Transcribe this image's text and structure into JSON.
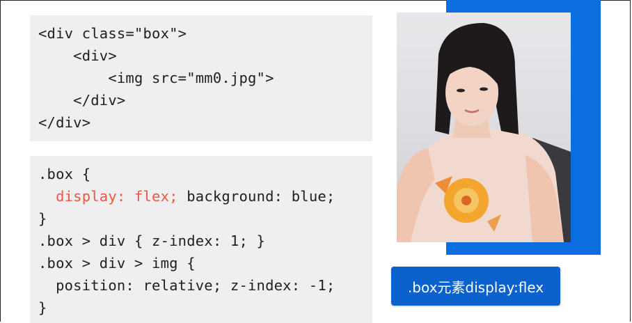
{
  "html_code": {
    "lines": [
      "<div class=\"box\">",
      "    <div>",
      "        <img src=\"mm0.jpg\">",
      "    </div>",
      "</div>"
    ]
  },
  "css_code": {
    "line1": ".box {",
    "line2_highlight": "  display: flex;",
    "line2_rest": " background: blue;",
    "line3": "}",
    "line4": ".box > div { z-index: 1; }",
    "line5": ".box > div > img {",
    "line6": "  position: relative; z-index: -1;",
    "line7": "}"
  },
  "label": {
    "text": ".box元素display:flex"
  },
  "colors": {
    "blue_box": "#0a6ee0",
    "label_bg": "#0c62cc",
    "highlight": "#e8583c",
    "code_bg": "#efeef0"
  },
  "photo": {
    "icon": "photo-of-girl"
  }
}
